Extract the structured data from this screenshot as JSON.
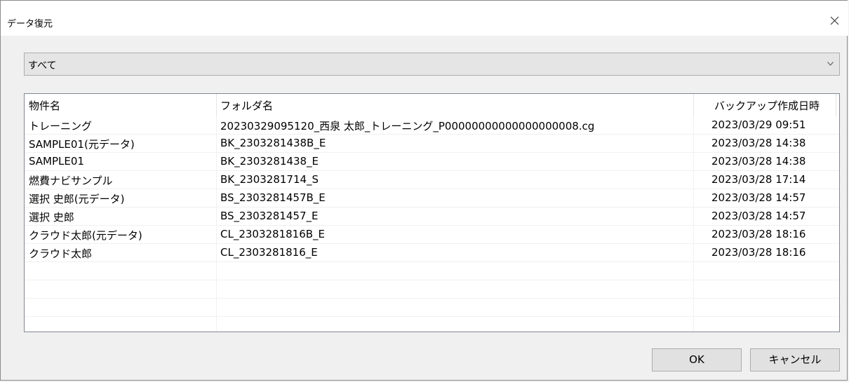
{
  "window": {
    "title": "データ復元"
  },
  "filter": {
    "selected": "すべて"
  },
  "table": {
    "columns": [
      "物件名",
      "フォルダ名",
      "バックアップ作成日時"
    ],
    "rows": [
      [
        "トレーニング",
        "20230329095120_西泉 太郎_トレーニング_P00000000000000000008.cg",
        "2023/03/29 09:51"
      ],
      [
        "SAMPLE01(元データ)",
        "BK_2303281438B_E",
        "2023/03/28 14:38"
      ],
      [
        "SAMPLE01",
        "BK_2303281438_E",
        "2023/03/28 14:38"
      ],
      [
        "燃費ナビサンプル",
        "BK_2303281714_S",
        "2023/03/28 17:14"
      ],
      [
        "選択 史郎(元データ)",
        "BS_2303281457B_E",
        "2023/03/28 14:57"
      ],
      [
        "選択 史郎",
        "BS_2303281457_E",
        "2023/03/28 14:57"
      ],
      [
        "クラウド太郎(元データ)",
        "CL_2303281816B_E",
        "2023/03/28 18:16"
      ],
      [
        "クラウド太郎",
        "CL_2303281816_E",
        "2023/03/28 18:16"
      ]
    ]
  },
  "buttons": {
    "ok": "OK",
    "cancel": "キャンセル"
  },
  "icons": {
    "close": "close-icon",
    "dropdown": "chevron-down-icon"
  }
}
